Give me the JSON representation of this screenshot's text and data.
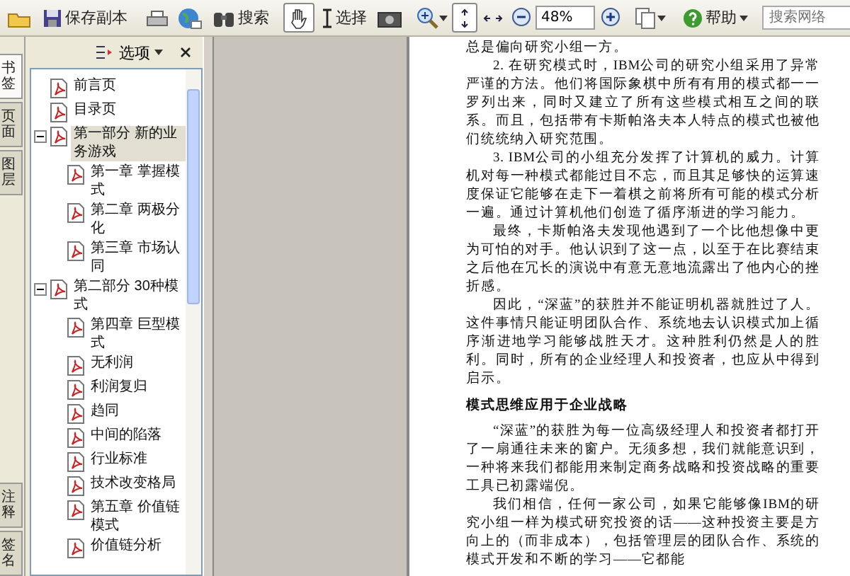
{
  "toolbar": {
    "save_copy": {
      "label": "保存副本"
    },
    "search": {
      "label": "搜索"
    },
    "hand_tool": {
      "selected": true
    },
    "select_tool": {
      "label": "选择",
      "selected": false
    },
    "zoom": {
      "value": "48%"
    },
    "help": {
      "label": "帮助"
    },
    "web_search": {
      "placeholder": "搜索网络"
    }
  },
  "side_tabs": [
    {
      "label": "书签",
      "selected": true
    },
    {
      "label": "页面",
      "selected": false
    },
    {
      "label": "图层",
      "selected": false
    }
  ],
  "bottom_tabs": [
    {
      "label": "注释",
      "selected": false
    },
    {
      "label": "签名",
      "selected": false
    }
  ],
  "panel": {
    "options_label": "选项",
    "tree": [
      {
        "label": "前言页",
        "selected": false
      },
      {
        "label": "目录页",
        "selected": false
      },
      {
        "label": "第一部分 新的业务游戏",
        "selected": true,
        "expanded": true,
        "children": [
          {
            "label": "第一章 掌握模式",
            "selected": false
          },
          {
            "label": "第二章 两极分化",
            "selected": false
          },
          {
            "label": "第三章 市场认同",
            "selected": false
          }
        ]
      },
      {
        "label": "第二部分 30种模式",
        "selected": false,
        "expanded": true,
        "children": [
          {
            "label": "第四章 巨型模式",
            "selected": false
          },
          {
            "label": "无利润",
            "selected": false
          },
          {
            "label": "利润复归",
            "selected": false
          },
          {
            "label": "趋同",
            "selected": false
          },
          {
            "label": "中间的陷落",
            "selected": false
          },
          {
            "label": "行业标准",
            "selected": false
          },
          {
            "label": "技术改变格局",
            "selected": false
          },
          {
            "label": "第五章 价值链模式",
            "selected": false
          },
          {
            "label": "价值链分析",
            "selected": false
          }
        ]
      }
    ]
  },
  "document": {
    "blocks": [
      {
        "kind": "continuation",
        "text": "总是偏向研究小组一方。"
      },
      {
        "kind": "paragraph",
        "text": "2. 在研究模式时，IBM公司的研究小组采用了异常严谨的方法。他们将国际象棋中所有有用的模式都一一罗列出来，同时又建立了所有这些模式相互之间的联系。而且，包括带有卡斯帕洛夫本人特点的模式也被他们统统纳入研究范围。"
      },
      {
        "kind": "paragraph",
        "text": "3. IBM公司的小组充分发挥了计算机的威力。计算机对每一种模式都能过目不忘，而且其足够快的运算速度保证它能够在走下一着棋之前将所有可能的模式分析一遍。通过计算机他们创造了循序渐进的学习能力。"
      },
      {
        "kind": "paragraph",
        "text": "最终，卡斯帕洛夫发现他遇到了一个比他想像中更为可怕的对手。他认识到了这一点，以至于在比赛结束之后他在冗长的演说中有意无意地流露出了他内心的挫折感。"
      },
      {
        "kind": "paragraph",
        "text": "因此，“深蓝”的获胜并不能证明机器就胜过了人。这件事情只能证明团队合作、系统地去认识模式加上循序渐进地学习能够战胜天才。这种胜利仍然是人的胜利。同时，所有的企业经理人和投资者，也应从中得到启示。"
      },
      {
        "kind": "heading",
        "text": "模式思维应用于企业战略"
      },
      {
        "kind": "paragraph",
        "text": "“深蓝”的获胜为每一位高级经理人和投资者都打开了一扇通往未来的窗户。无须多想，我们就能意识到，一种将来我们都能用来制定商务战略和投资战略的重要工具已初露端倪。"
      },
      {
        "kind": "paragraph",
        "text": "我们相信，任何一家公司，如果它能够像IBM的研究小组一样为模式研究投资的话——这种投资主要是方向上的（而非成本），包括管理层的团队合作、系统的模式开发和不断的学习——它都能"
      }
    ]
  }
}
